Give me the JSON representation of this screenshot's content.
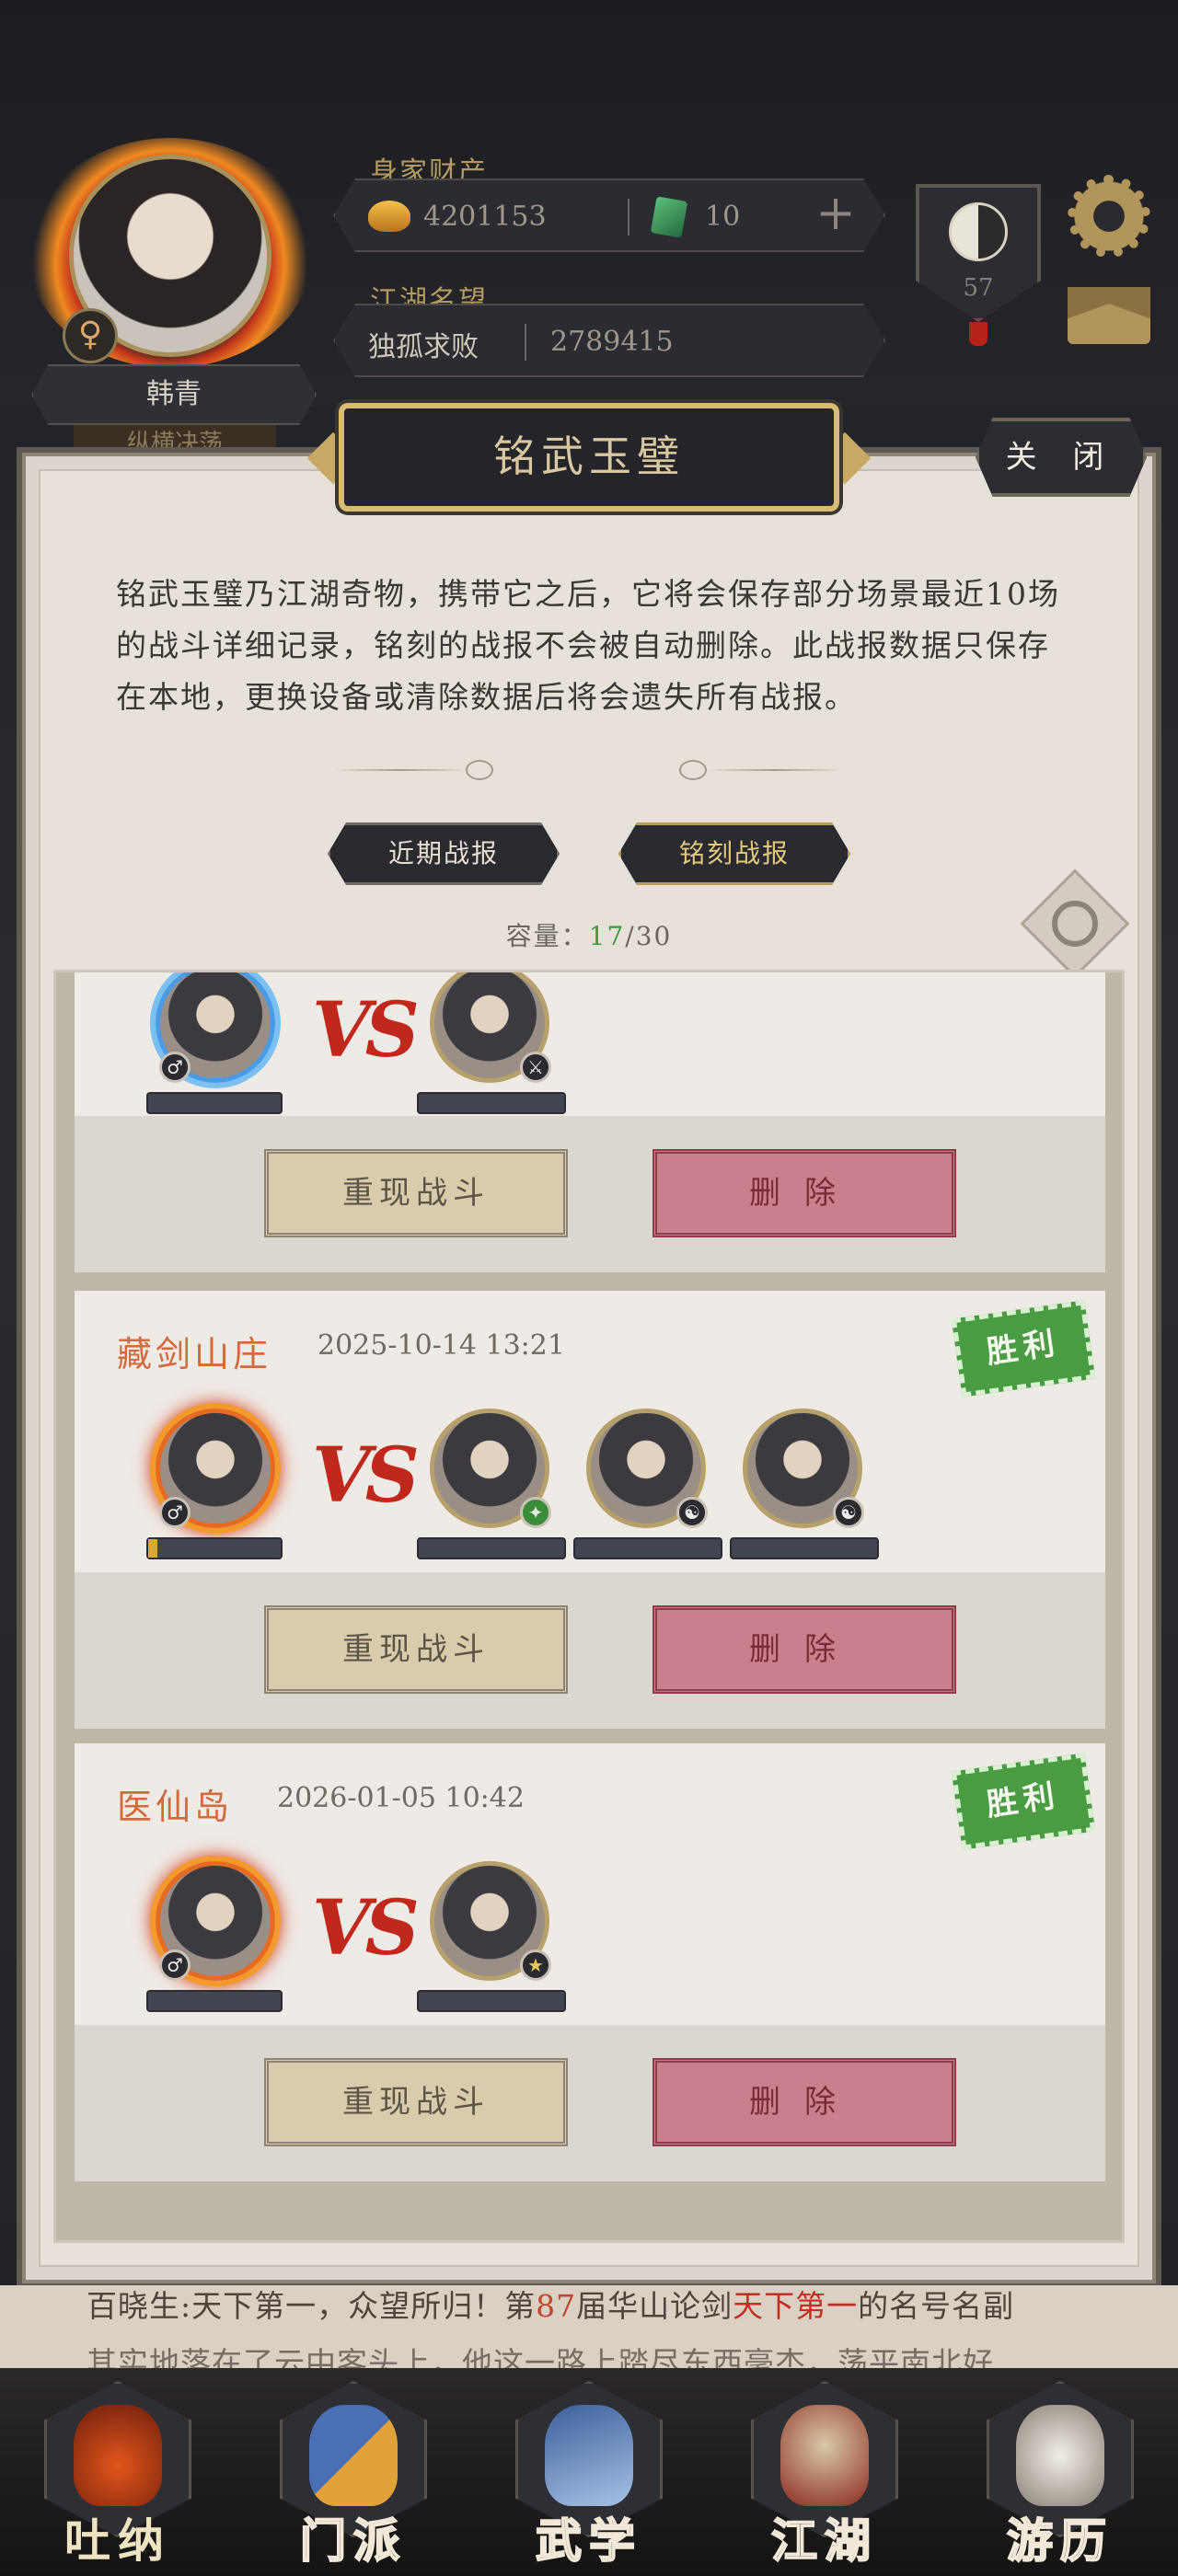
{
  "header": {
    "player_name": "韩青",
    "player_subtitle": "纵横决荡",
    "wealth_label": "身家财产",
    "gold_amount": "4201153",
    "jade_amount": "10",
    "fame_label": "江湖名望",
    "fame_title": "独孤求败",
    "fame_value": "2789415",
    "rank_level": "57",
    "gender_symbol": "♀"
  },
  "modal": {
    "title": "铭武玉璧",
    "close_label": "关 闭",
    "description": "铭武玉璧乃江湖奇物，携带它之后，它将会保存部分场景最近10场的战斗详细记录，铭刻的战报不会被自动删除。此战报数据只保存在本地，更换设备或清除数据后将会遗失所有战报。",
    "tabs": [
      {
        "label": "近期战报"
      },
      {
        "label": "铭刻战报"
      }
    ],
    "capacity_label": "容量：",
    "capacity_used": "17",
    "capacity_total": "/30"
  },
  "records": [
    {
      "place": "",
      "time": "",
      "result": "",
      "replay_label": "重现战斗",
      "delete_label": "删除"
    },
    {
      "place": "藏剑山庄",
      "time": "2025-10-14 13:21",
      "result": "胜利",
      "replay_label": "重现战斗",
      "delete_label": "删除"
    },
    {
      "place": "医仙岛",
      "time": "2026-01-05 10:42",
      "result": "胜利",
      "replay_label": "重现战斗",
      "delete_label": "删除"
    }
  ],
  "vs_label": "VS",
  "ticker": {
    "prefix": "百晓生:天下第一，众望所归！第",
    "number": "87",
    "middle": "届华山论剑",
    "highlight": "天下第一",
    "suffix": "的名号名副",
    "line2": "其实地落在了云中客头上，他这一路上踏尽东西毫杰，荡平南北好"
  },
  "nav": [
    {
      "label": "吐纳",
      "icon": "gourd-icon"
    },
    {
      "label": "门派",
      "icon": "banner-icon"
    },
    {
      "label": "武学",
      "icon": "book-icon"
    },
    {
      "label": "江湖",
      "icon": "hat-icon"
    },
    {
      "label": "游历",
      "icon": "horse-icon"
    }
  ],
  "colors": {
    "accent_gold": "#d8bb74",
    "win_green": "#4a9c42",
    "delete_pink": "#cb7f8e",
    "place_orange": "#d36a3c"
  }
}
